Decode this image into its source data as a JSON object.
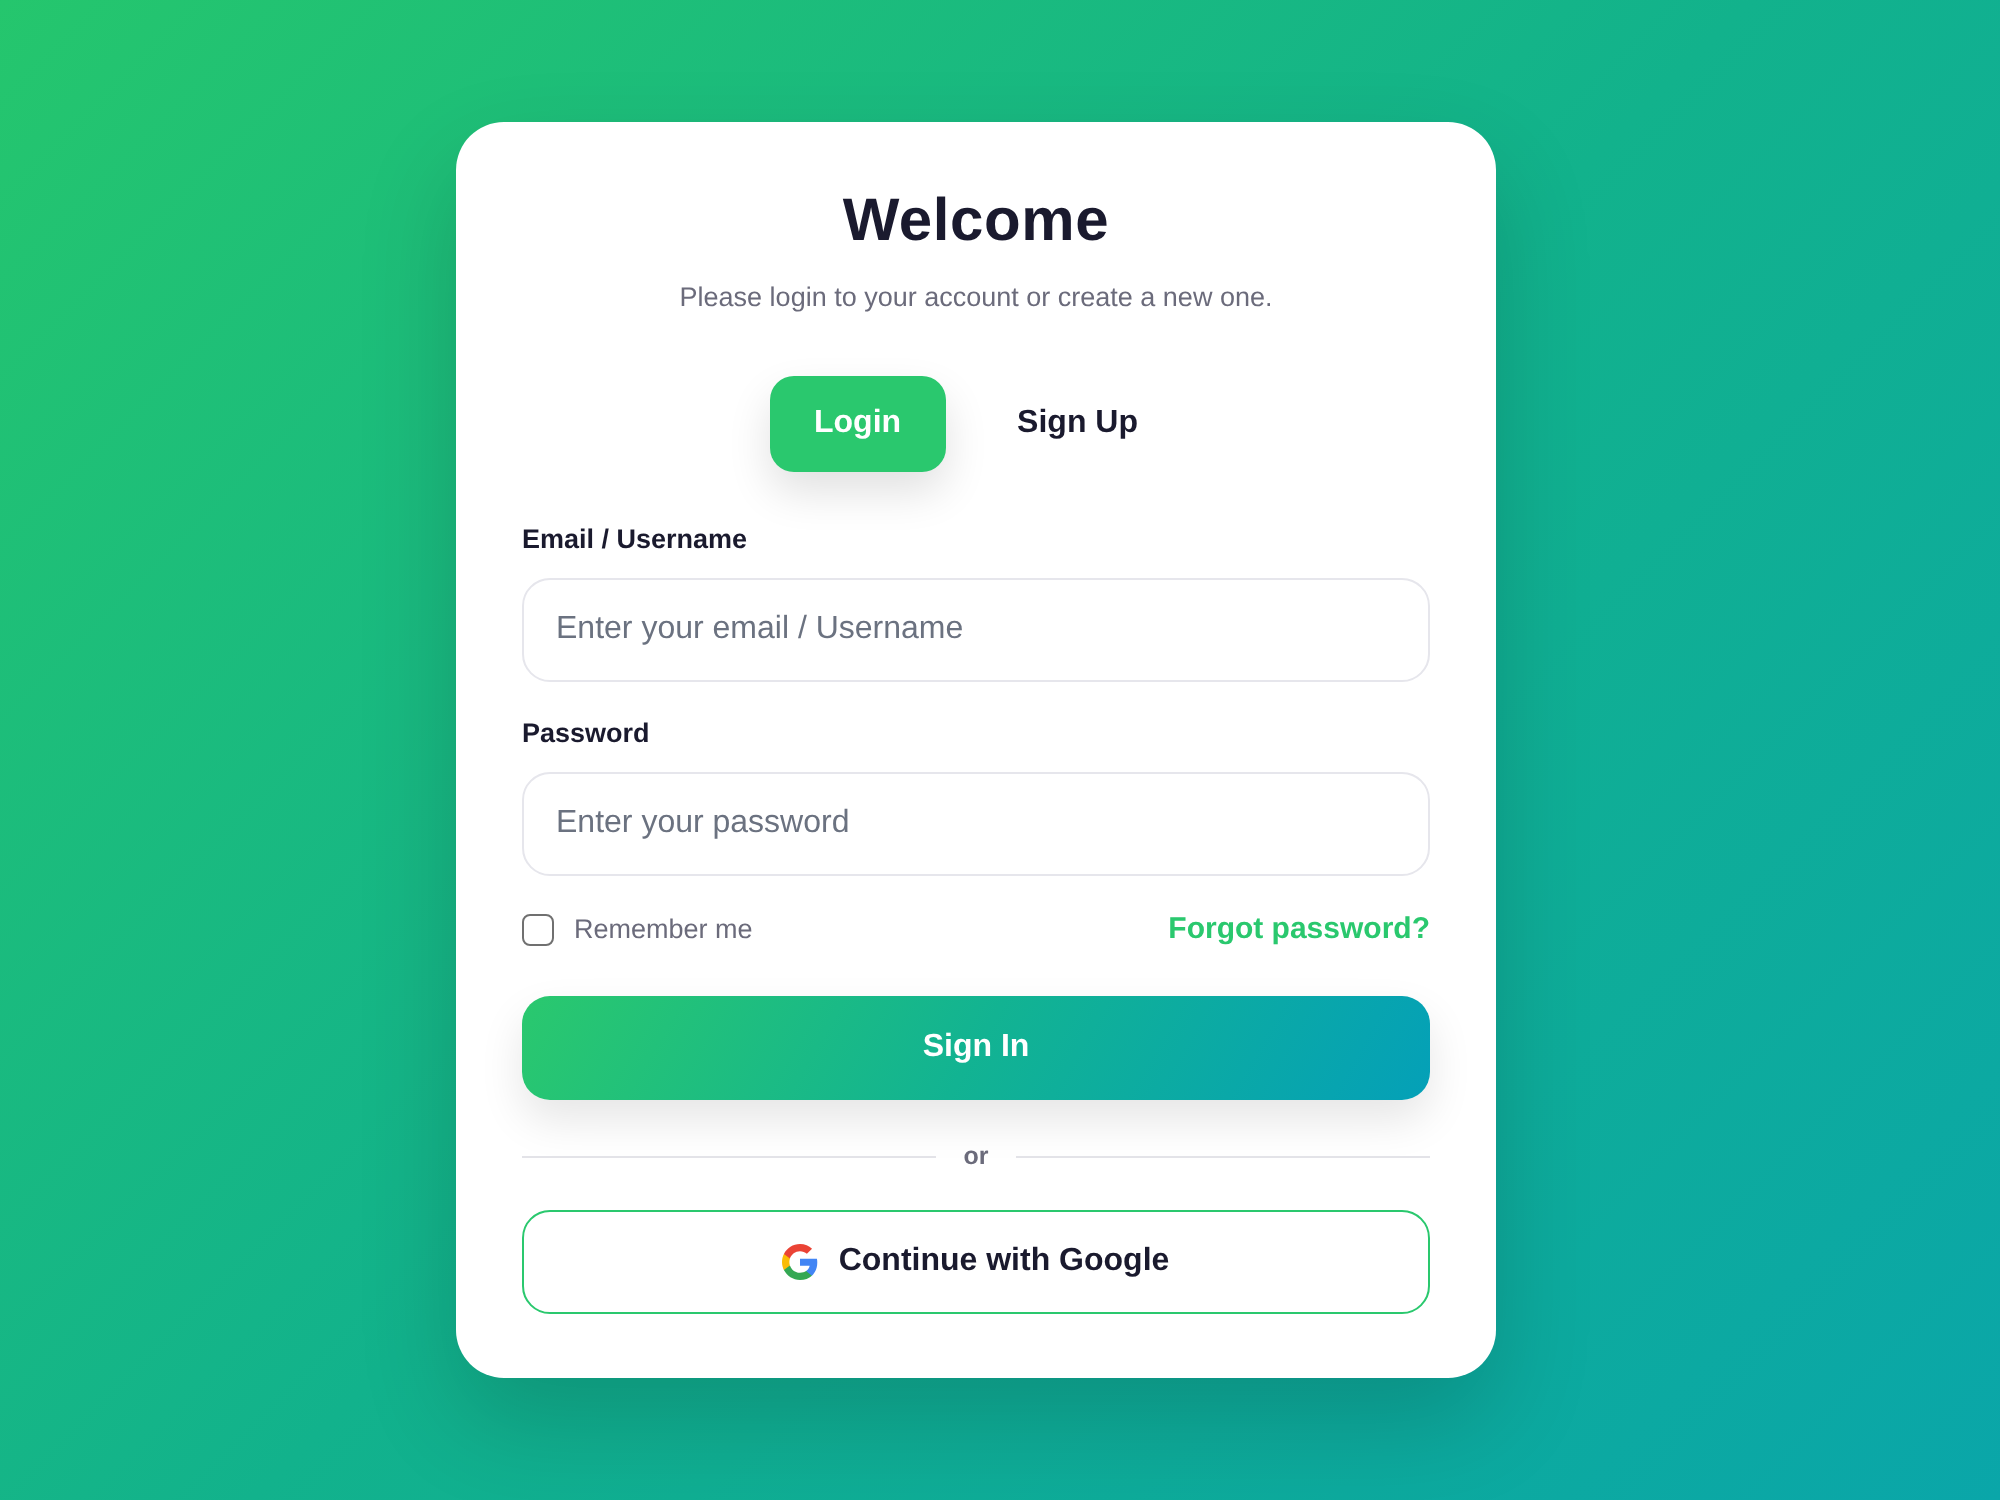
{
  "card": {
    "title": "Welcome",
    "subtitle": "Please login to your account or create a new one."
  },
  "tabs": [
    {
      "label": "Login",
      "selected": true
    },
    {
      "label": "Sign Up",
      "selected": false
    }
  ],
  "fields": [
    {
      "label": "Email / Username",
      "placeholder": "Enter your email / Username"
    },
    {
      "label": "Password",
      "placeholder": "Enter your password"
    }
  ],
  "remember": {
    "label": "Remember me",
    "checked": false
  },
  "forgot_link": "Forgot password?",
  "sign_in_button": "Sign In",
  "divider": "or",
  "google_button": "Continue with Google"
}
